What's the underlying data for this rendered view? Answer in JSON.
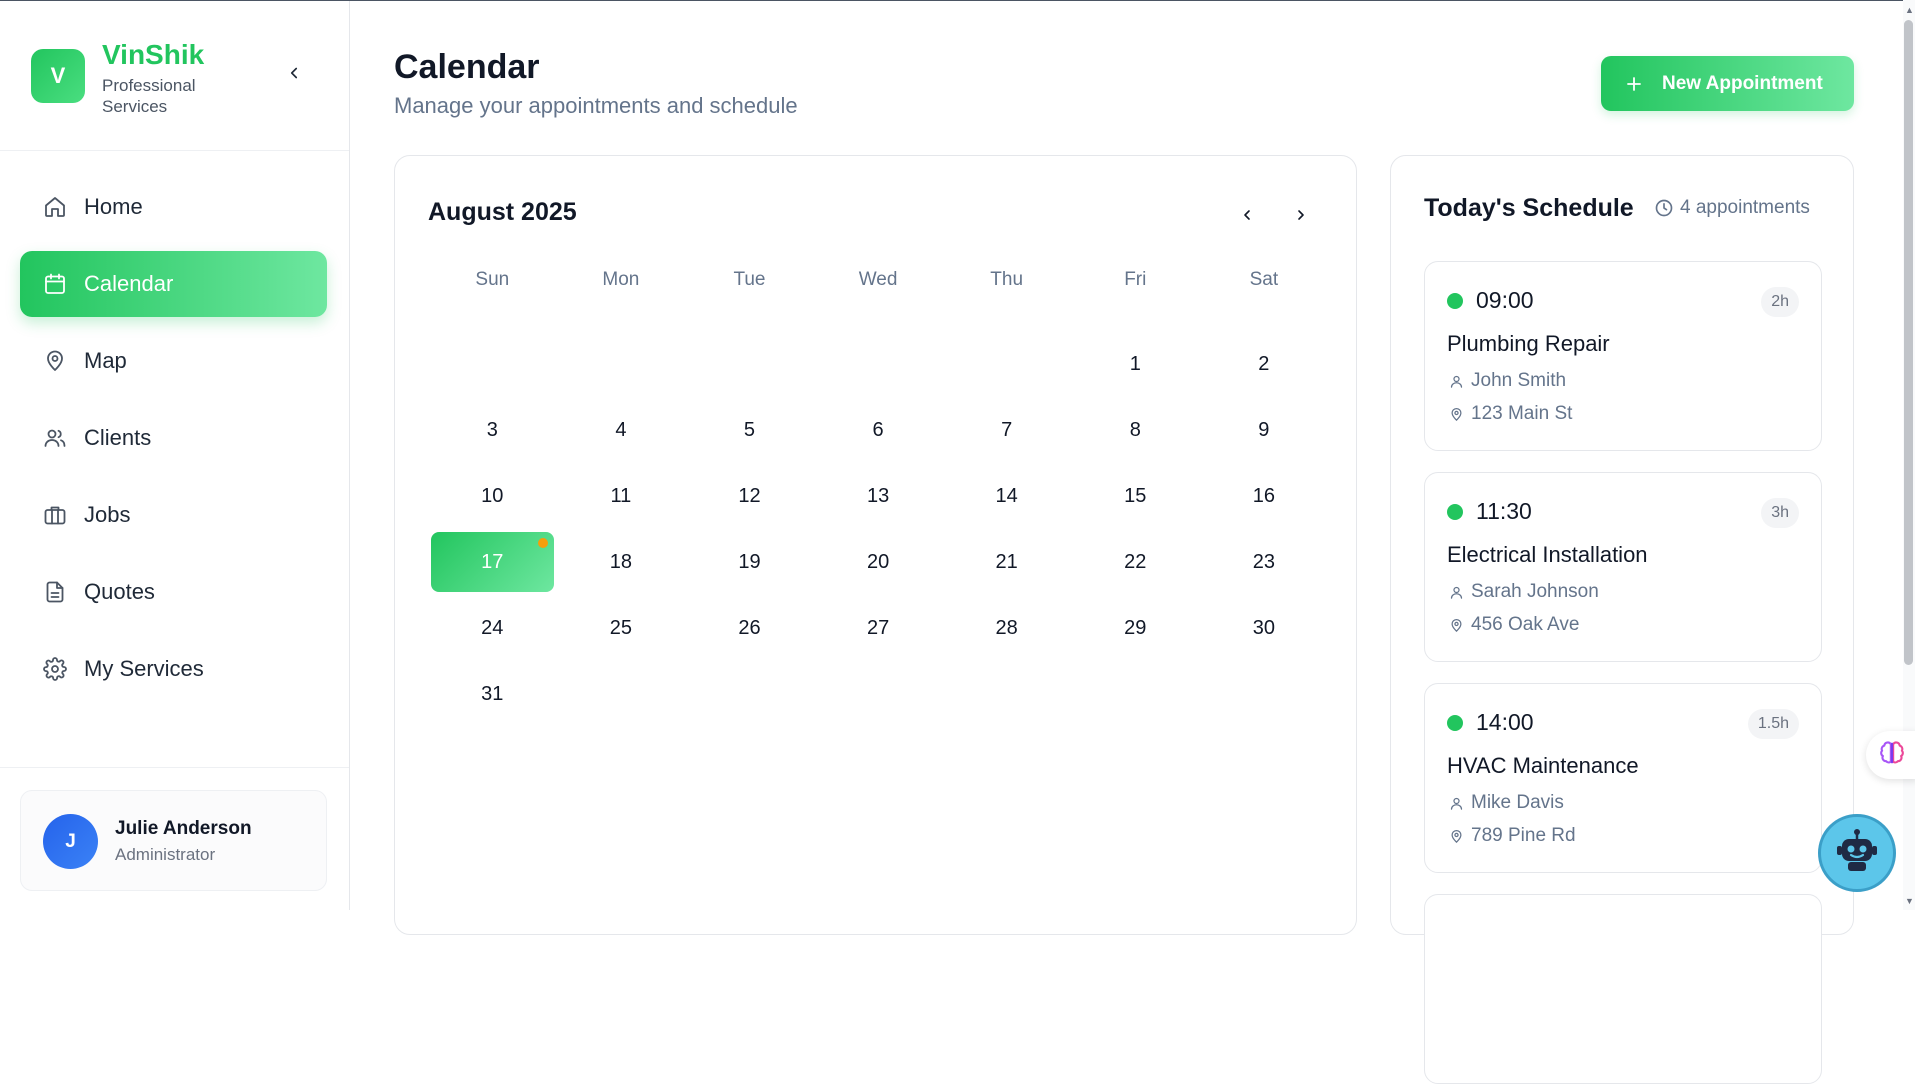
{
  "brand": {
    "logo_letter": "V",
    "name": "VinShik",
    "subtitle": "Professional Services",
    "accent": "#22c55e"
  },
  "sidebar": {
    "collapse_icon": "chevron-left-icon",
    "items": [
      {
        "label": "Home",
        "icon": "home-icon",
        "active": false
      },
      {
        "label": "Calendar",
        "icon": "calendar-icon",
        "active": true
      },
      {
        "label": "Map",
        "icon": "map-pin-icon",
        "active": false
      },
      {
        "label": "Clients",
        "icon": "users-icon",
        "active": false
      },
      {
        "label": "Jobs",
        "icon": "briefcase-icon",
        "active": false
      },
      {
        "label": "Quotes",
        "icon": "file-text-icon",
        "active": false
      },
      {
        "label": "My Services",
        "icon": "gear-icon",
        "active": false
      }
    ]
  },
  "user": {
    "initial": "J",
    "name": "Julie Anderson",
    "role": "Administrator"
  },
  "header": {
    "title": "Calendar",
    "subtitle": "Manage your appointments and schedule",
    "new_button": {
      "icon": "plus-icon",
      "label": "New Appointment"
    }
  },
  "calendar": {
    "month_label": "August 2025",
    "weekdays": [
      "Sun",
      "Mon",
      "Tue",
      "Wed",
      "Thu",
      "Fri",
      "Sat"
    ],
    "leading_blanks": 5,
    "days_in_month": 31,
    "selected_day": 17,
    "days_with_events": [
      17
    ],
    "event_dot_color": "#f59e0b"
  },
  "schedule": {
    "title": "Today's Schedule",
    "count_icon": "clock-icon",
    "count_label": "4 appointments",
    "appointments": [
      {
        "time": "09:00",
        "duration": "2h",
        "service": "Plumbing Repair",
        "client": "John Smith",
        "address": "123 Main St",
        "status_color": "#22c55e"
      },
      {
        "time": "11:30",
        "duration": "3h",
        "service": "Electrical Installation",
        "client": "Sarah Johnson",
        "address": "456 Oak Ave",
        "status_color": "#22c55e"
      },
      {
        "time": "14:00",
        "duration": "1.5h",
        "service": "HVAC Maintenance",
        "client": "Mike Davis",
        "address": "789 Pine Rd",
        "status_color": "#22c55e"
      }
    ]
  },
  "floating": {
    "brain_icon": "brain-icon",
    "bot_icon": "robot-icon"
  }
}
